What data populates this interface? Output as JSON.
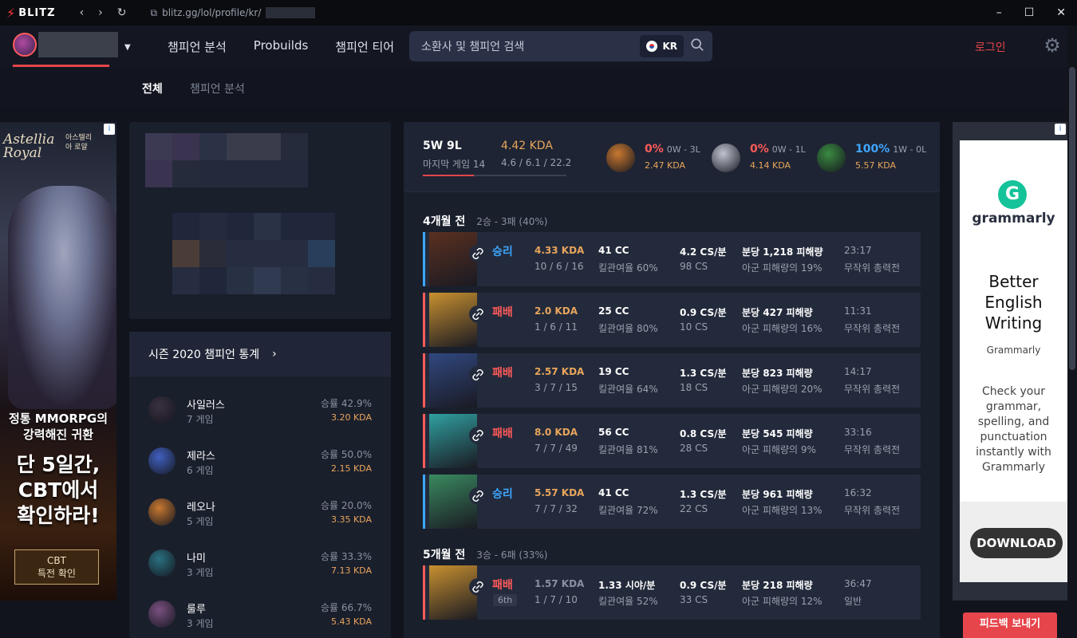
{
  "browser": {
    "brand": "BLITZ",
    "url": "blitz.gg/lol/profile/kr/"
  },
  "header": {
    "nav": [
      "챔피언 분석",
      "Probuilds",
      "챔피언 티어"
    ],
    "search_placeholder": "소환사 및 챔피언 검색",
    "region": "KR",
    "login": "로그인"
  },
  "subnav": {
    "tab_all": "전체",
    "tab_champ": "챔피언 분석"
  },
  "ad_left": {
    "brand": "Astellia Royal",
    "brand_ko": "아스텔리아 로얄",
    "line1": "정통 MMORPG의",
    "line2": "강력해진 귀환",
    "big1": "단 5일간,",
    "big2": "CBT에서",
    "big3": "확인하라!",
    "cta1": "CBT",
    "cta2": "특전 확인"
  },
  "season_stats": {
    "title": "시즌 2020 챔피언 통계",
    "champions": [
      {
        "name": "사일러스",
        "games": "7 게임",
        "winrate": "승률 42.9%",
        "kda": "3.20 KDA",
        "color": "#3a3040"
      },
      {
        "name": "제라스",
        "games": "6 게임",
        "winrate": "승률 50.0%",
        "kda": "2.15 KDA",
        "color": "#4060c0"
      },
      {
        "name": "레오나",
        "games": "5 게임",
        "winrate": "승률 20.0%",
        "kda": "3.35 KDA",
        "color": "#c87830"
      },
      {
        "name": "나미",
        "games": "3 게임",
        "winrate": "승률 33.3%",
        "kda": "7.13 KDA",
        "color": "#2a7080"
      },
      {
        "name": "룰루",
        "games": "3 게임",
        "winrate": "승률 66.7%",
        "kda": "5.43 KDA",
        "color": "#7a5080"
      }
    ]
  },
  "summary": {
    "record": "5W 9L",
    "last_games": "마지막 게임 14",
    "kda": "4.42 KDA",
    "kda_detail": "4.6 / 6.1 / 22.2",
    "win_fraction": 0.357,
    "recent": [
      {
        "winrate": "0%",
        "wl": "0W - 3L",
        "kda": "2.47 KDA",
        "win": false,
        "color": "#c87830"
      },
      {
        "winrate": "0%",
        "wl": "0W - 1L",
        "kda": "4.14 KDA",
        "win": false,
        "color": "#c0c4d0"
      },
      {
        "winrate": "100%",
        "wl": "1W - 0L",
        "kda": "5.57 KDA",
        "win": true,
        "color": "#3a8a40"
      }
    ]
  },
  "periods": [
    {
      "label": "4개월 전",
      "record": "2승 - 3패 (40%)",
      "matches": [
        {
          "result": "승리",
          "win": true,
          "kda": "4.33 KDA",
          "kda_detail": "10 / 6 / 16",
          "cc": "41 CC",
          "kp": "킬관여율 60%",
          "cs": "4.2 CS/분",
          "cs_total": "98 CS",
          "dmg": "분당 1,218 피해량",
          "dmg_pct": "아군 피해량의 19%",
          "time": "23:17",
          "mode": "무작위 총력전",
          "color": "#5a3020"
        },
        {
          "result": "패배",
          "win": false,
          "kda": "2.0 KDA",
          "kda_detail": "1 / 6 / 11",
          "cc": "25 CC",
          "kp": "킬관여율 80%",
          "cs": "0.9 CS/분",
          "cs_total": "10 CS",
          "dmg": "분당 427 피해량",
          "dmg_pct": "아군 피해량의 16%",
          "time": "11:31",
          "mode": "무작위 총력전",
          "color": "#c89030"
        },
        {
          "result": "패배",
          "win": false,
          "kda": "2.57 KDA",
          "kda_detail": "3 / 7 / 15",
          "cc": "19 CC",
          "kp": "킬관여율 64%",
          "cs": "1.3 CS/분",
          "cs_total": "18 CS",
          "dmg": "분당 823 피해량",
          "dmg_pct": "아군 피해량의 20%",
          "time": "14:17",
          "mode": "무작위 총력전",
          "color": "#304880"
        },
        {
          "result": "패배",
          "win": false,
          "kda": "8.0 KDA",
          "kda_detail": "7 / 7 / 49",
          "cc": "56 CC",
          "kp": "킬관여율 81%",
          "cs": "0.8 CS/분",
          "cs_total": "28 CS",
          "dmg": "분당 545 피해량",
          "dmg_pct": "아군 피해량의 9%",
          "time": "33:16",
          "mode": "무작위 총력전",
          "color": "#30a0a0"
        },
        {
          "result": "승리",
          "win": true,
          "kda": "5.57 KDA",
          "kda_detail": "7 / 7 / 32",
          "cc": "41 CC",
          "kp": "킬관여율 72%",
          "cs": "1.3 CS/분",
          "cs_total": "22 CS",
          "dmg": "분당 961 피해량",
          "dmg_pct": "아군 피해량의 13%",
          "time": "16:32",
          "mode": "무작위 총력전",
          "color": "#3a8a60"
        }
      ]
    },
    {
      "label": "5개월 전",
      "record": "3승 - 6패 (33%)",
      "matches": [
        {
          "result": "패배",
          "rank": "6th",
          "win": false,
          "kda": "1.57 KDA",
          "kda_detail": "1 / 7 / 10",
          "cc": "1.33 시야/분",
          "kp": "킬관여율 52%",
          "cs": "0.9 CS/분",
          "cs_total": "33 CS",
          "dmg": "분당 218 피해량",
          "dmg_pct": "아군 피해량의 12%",
          "time": "36:47",
          "mode": "일반",
          "color": "#c89030"
        }
      ]
    }
  ],
  "ad_right": {
    "brand": "grammarly",
    "headline": "Better English Writing",
    "sub": "Grammarly",
    "body": "Check your grammar, spelling, and punctuation instantly with Grammarly",
    "cta": "DOWNLOAD"
  },
  "feedback": "피드백 보내기",
  "colors": {
    "win": "#3ea6ff",
    "loss": "#ff5a5a",
    "kda": "#e8a55c",
    "accent": "#e5454b"
  }
}
